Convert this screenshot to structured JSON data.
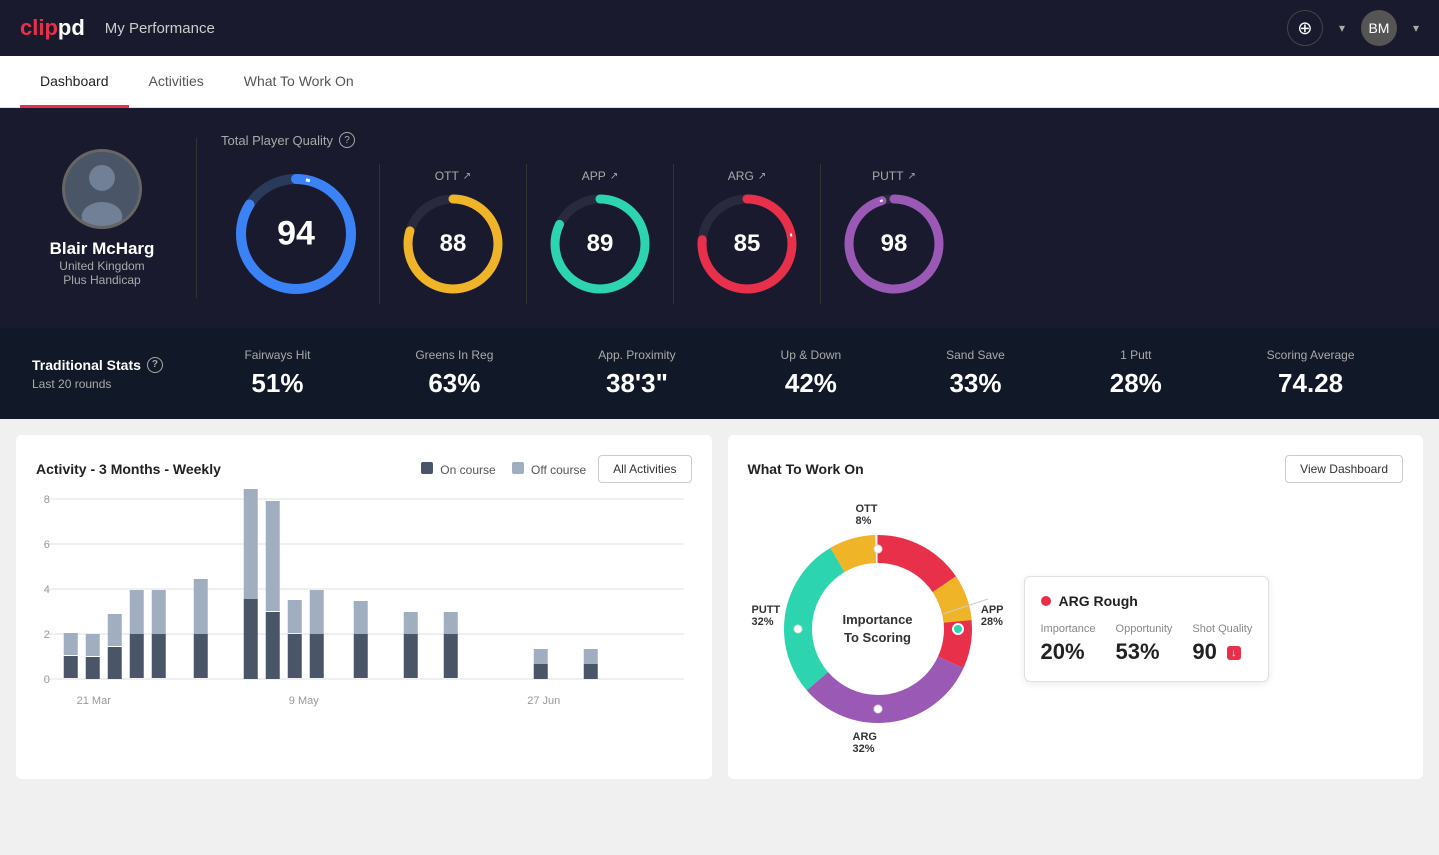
{
  "header": {
    "logo": "clippd",
    "title": "My Performance",
    "add_icon": "+",
    "avatar_label": "BM"
  },
  "nav": {
    "tabs": [
      {
        "label": "Dashboard",
        "active": true
      },
      {
        "label": "Activities",
        "active": false
      },
      {
        "label": "What To Work On",
        "active": false
      }
    ]
  },
  "stats_panel": {
    "quality_label": "Total Player Quality",
    "player": {
      "name": "Blair McHarg",
      "country": "United Kingdom",
      "handicap": "Plus Handicap"
    },
    "main_score": 94,
    "gauges": [
      {
        "label": "OTT",
        "value": 88,
        "color": "#f0b429",
        "bg": "#2a2a3e"
      },
      {
        "label": "APP",
        "value": 89,
        "color": "#2dd4b0",
        "bg": "#2a2a3e"
      },
      {
        "label": "ARG",
        "value": 85,
        "color": "#e8304a",
        "bg": "#2a2a3e"
      },
      {
        "label": "PUTT",
        "value": 98,
        "color": "#9b59b6",
        "bg": "#2a2a3e"
      }
    ]
  },
  "traditional_stats": {
    "title": "Traditional Stats",
    "subtitle": "Last 20 rounds",
    "items": [
      {
        "label": "Fairways Hit",
        "value": "51%"
      },
      {
        "label": "Greens In Reg",
        "value": "63%"
      },
      {
        "label": "App. Proximity",
        "value": "38'3\""
      },
      {
        "label": "Up & Down",
        "value": "42%"
      },
      {
        "label": "Sand Save",
        "value": "33%"
      },
      {
        "label": "1 Putt",
        "value": "28%"
      },
      {
        "label": "Scoring Average",
        "value": "74.28"
      }
    ]
  },
  "activity_chart": {
    "title": "Activity - 3 Months - Weekly",
    "legend": {
      "on_course": "On course",
      "off_course": "Off course"
    },
    "all_activities_btn": "All Activities",
    "x_labels": [
      "21 Mar",
      "9 May",
      "27 Jun"
    ],
    "bars": [
      {
        "on": 1,
        "off": 1.2
      },
      {
        "on": 1,
        "off": 1.0
      },
      {
        "on": 1.5,
        "off": 1.5
      },
      {
        "on": 2,
        "off": 2
      },
      {
        "on": 2,
        "off": 2
      },
      {
        "on": 2,
        "off": 2.5
      },
      {
        "on": 3.5,
        "off": 5
      },
      {
        "on": 3,
        "off": 5
      },
      {
        "on": 2,
        "off": 1.5
      },
      {
        "on": 2,
        "off": 2
      },
      {
        "on": 1.5,
        "off": 1.5
      },
      {
        "on": 2,
        "off": 1
      },
      {
        "on": 1,
        "off": 1
      },
      {
        "on": 0.5,
        "off": 0.3
      },
      {
        "on": 0.5,
        "off": 0.3
      }
    ],
    "y_labels": [
      "0",
      "2",
      "4",
      "6",
      "8"
    ]
  },
  "what_to_work_on": {
    "title": "What To Work On",
    "view_dashboard_btn": "View Dashboard",
    "donut_center": "Importance\nTo Scoring",
    "segments": [
      {
        "label": "OTT",
        "value": "8%",
        "color": "#f0b429"
      },
      {
        "label": "APP",
        "value": "28%",
        "color": "#2dd4b0"
      },
      {
        "label": "ARG",
        "value": "32%",
        "color": "#e8304a"
      },
      {
        "label": "PUTT",
        "value": "32%",
        "color": "#9b59b6"
      }
    ],
    "detail_card": {
      "title": "ARG Rough",
      "dot_color": "#e8304a",
      "metrics": [
        {
          "label": "Importance",
          "value": "20%"
        },
        {
          "label": "Opportunity",
          "value": "53%"
        },
        {
          "label": "Shot Quality",
          "value": "90",
          "badge": "↓"
        }
      ]
    }
  }
}
